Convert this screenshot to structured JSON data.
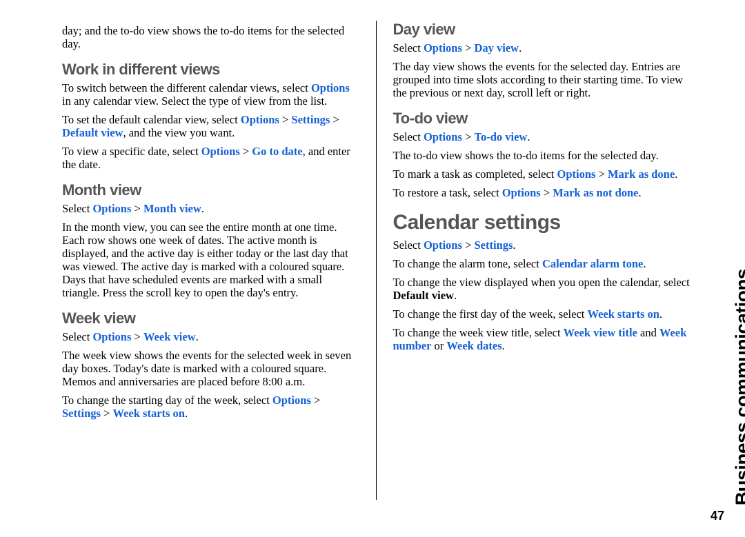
{
  "sideLabel": "Business communications",
  "pageNumber": "47",
  "left": {
    "introPara": "day; and the to-do view shows the to-do items for the selected day.",
    "workHeading": "Work in different views",
    "work_p1_a": "To switch between the different calendar views, select ",
    "work_p1_b": "Options",
    "work_p1_c": " in any calendar view. Select the type of view from the list.",
    "work_p2_a": "To set the default calendar view, select ",
    "work_p2_b": "Options",
    "work_p2_c": " > ",
    "work_p2_d": "Settings",
    "work_p2_e": " > ",
    "work_p2_f": "Default view",
    "work_p2_g": ", and the view you want.",
    "work_p3_a": "To view a specific date, select ",
    "work_p3_b": "Options",
    "work_p3_c": " > ",
    "work_p3_d": "Go to date",
    "work_p3_e": ", and enter the date.",
    "monthHeading": "Month view",
    "month_sel_a": "Select ",
    "month_sel_b": "Options",
    "month_sel_c": " > ",
    "month_sel_d": "Month view",
    "month_sel_e": ".",
    "month_p1": "In the month view, you can see the entire month at one time. Each row shows one week of dates. The active month is displayed, and the active day is either today or the last day that was viewed. The active day is marked with a coloured square. Days that have scheduled events are marked with a small triangle. Press the scroll key to open the day's entry.",
    "weekHeading": "Week view",
    "week_sel_a": "Select ",
    "week_sel_b": "Options",
    "week_sel_c": " > ",
    "week_sel_d": "Week view",
    "week_sel_e": ".",
    "week_p1": "The week view shows the events for the selected week in seven day boxes. Today's date is marked with a coloured square. Memos and anniversaries are placed before 8:00 a.m.",
    "week_p2_a": "To change the starting day of the week, select ",
    "week_p2_b": "Options",
    "week_p2_c": " > ",
    "week_p2_d": "Settings",
    "week_p2_e": " > ",
    "week_p2_f": "Week starts on",
    "week_p2_g": "."
  },
  "right": {
    "dayHeading": "Day view",
    "day_sel_a": "Select ",
    "day_sel_b": "Options",
    "day_sel_c": " > ",
    "day_sel_d": "Day view",
    "day_sel_e": ".",
    "day_p1": "The day view shows the events for the selected day. Entries are grouped into time slots according to their starting time. To view the previous or next day, scroll left or right.",
    "todoHeading": "To-do view",
    "todo_sel_a": "Select ",
    "todo_sel_b": "Options",
    "todo_sel_c": " > ",
    "todo_sel_d": "To-do view",
    "todo_sel_e": ".",
    "todo_p1": "The to-do view shows the to-do items for the selected day.",
    "todo_p2_a": "To mark a task as completed, select ",
    "todo_p2_b": "Options",
    "todo_p2_c": " > ",
    "todo_p2_d": "Mark as done",
    "todo_p2_e": ".",
    "todo_p3_a": "To restore a task, select ",
    "todo_p3_b": "Options",
    "todo_p3_c": " > ",
    "todo_p3_d": "Mark as not done",
    "todo_p3_e": ".",
    "calHeading": "Calendar settings",
    "cal_sel_a": "Select ",
    "cal_sel_b": "Options",
    "cal_sel_c": " > ",
    "cal_sel_d": "Settings",
    "cal_sel_e": ".",
    "cal_p1_a": "To change the alarm tone, select ",
    "cal_p1_b": "Calendar alarm tone",
    "cal_p1_c": ".",
    "cal_p2_a": "To change the view displayed when you open the calendar, select ",
    "cal_p2_b": "Default view",
    "cal_p2_c": ".",
    "cal_p3_a": "To change the first day of the week, select ",
    "cal_p3_b": "Week starts on",
    "cal_p3_c": ".",
    "cal_p4_a": "To change the week view title, select ",
    "cal_p4_b": "Week view title",
    "cal_p4_c": " and ",
    "cal_p4_d": "Week number",
    "cal_p4_e": " or ",
    "cal_p4_f": "Week dates",
    "cal_p4_g": "."
  }
}
